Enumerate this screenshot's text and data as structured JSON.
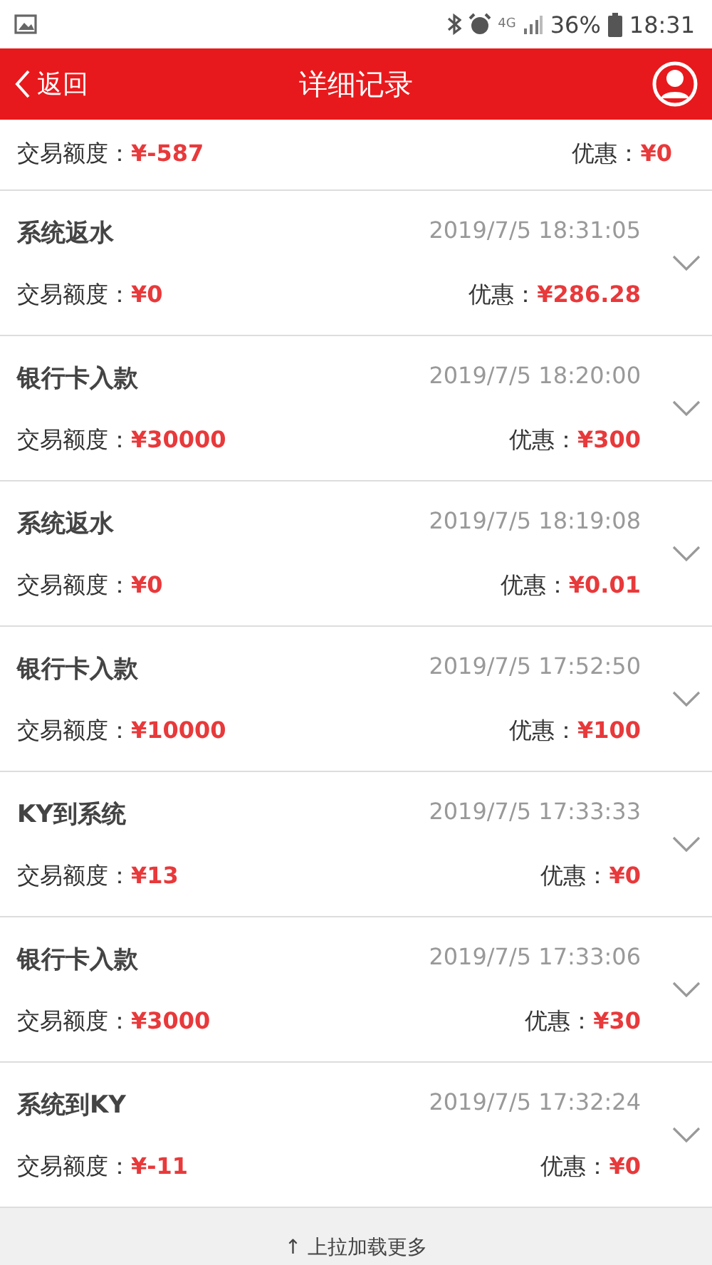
{
  "status_bar": {
    "battery": "36%",
    "time": "18:31",
    "network": "4G"
  },
  "header": {
    "back": "返回",
    "title": "详细记录"
  },
  "records": [
    {
      "partial": true,
      "amount_label": "交易额度：",
      "amount": "¥-587",
      "discount_label": "优惠：",
      "discount": "¥0"
    },
    {
      "partial": false,
      "title": "系统返水",
      "time": "2019/7/5 18:31:05",
      "amount_label": "交易额度：",
      "amount": "¥0",
      "discount_label": "优惠：",
      "discount": "¥286.28"
    },
    {
      "partial": false,
      "title": "银行卡入款",
      "time": "2019/7/5 18:20:00",
      "amount_label": "交易额度：",
      "amount": "¥30000",
      "discount_label": "优惠：",
      "discount": "¥300"
    },
    {
      "partial": false,
      "title": "系统返水",
      "time": "2019/7/5 18:19:08",
      "amount_label": "交易额度：",
      "amount": "¥0",
      "discount_label": "优惠：",
      "discount": "¥0.01"
    },
    {
      "partial": false,
      "title": "银行卡入款",
      "time": "2019/7/5 17:52:50",
      "amount_label": "交易额度：",
      "amount": "¥10000",
      "discount_label": "优惠：",
      "discount": "¥100"
    },
    {
      "partial": false,
      "title": "KY到系统",
      "time": "2019/7/5 17:33:33",
      "amount_label": "交易额度：",
      "amount": "¥13",
      "discount_label": "优惠：",
      "discount": "¥0"
    },
    {
      "partial": false,
      "title": "银行卡入款",
      "time": "2019/7/5 17:33:06",
      "amount_label": "交易额度：",
      "amount": "¥3000",
      "discount_label": "优惠：",
      "discount": "¥30"
    },
    {
      "partial": false,
      "title": "系统到KY",
      "time": "2019/7/5 17:32:24",
      "amount_label": "交易额度：",
      "amount": "¥-11",
      "discount_label": "优惠：",
      "discount": "¥0"
    }
  ],
  "footer": {
    "arrow": "↑",
    "text": "上拉加载更多"
  }
}
